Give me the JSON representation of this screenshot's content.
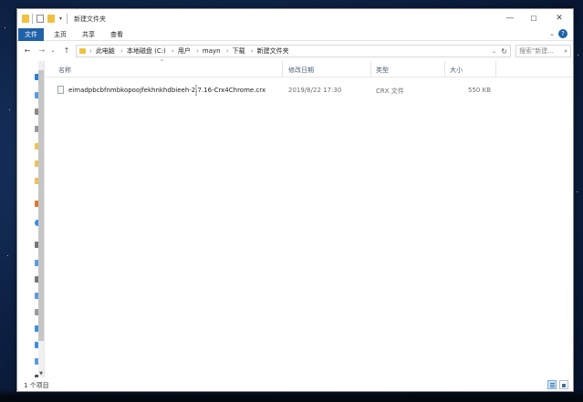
{
  "window": {
    "title": "新建文件夹"
  },
  "ribbon": {
    "tabs": [
      {
        "label": "文件"
      },
      {
        "label": "主页"
      },
      {
        "label": "共享"
      },
      {
        "label": "查看"
      }
    ]
  },
  "address": {
    "crumbs": [
      "此电脑",
      "本地磁盘 (C:)",
      "用户",
      "mayn",
      "下载",
      "新建文件夹"
    ]
  },
  "search": {
    "placeholder": "搜索\"新建..."
  },
  "columns": {
    "name": "名称",
    "date": "修改日期",
    "type": "类型",
    "size": "大小"
  },
  "files": [
    {
      "name": "eimadpbcbfnmbkopoojfekhnkhdbieeh-2.7.16-Crx4Chrome.crx",
      "date": "2019/8/22 17:30",
      "type": "CRX 文件",
      "size": "550 KB"
    }
  ],
  "status": {
    "count": "1 个项目"
  },
  "colors": {
    "accent": "#1f62a8",
    "folder": "#f0c040"
  }
}
